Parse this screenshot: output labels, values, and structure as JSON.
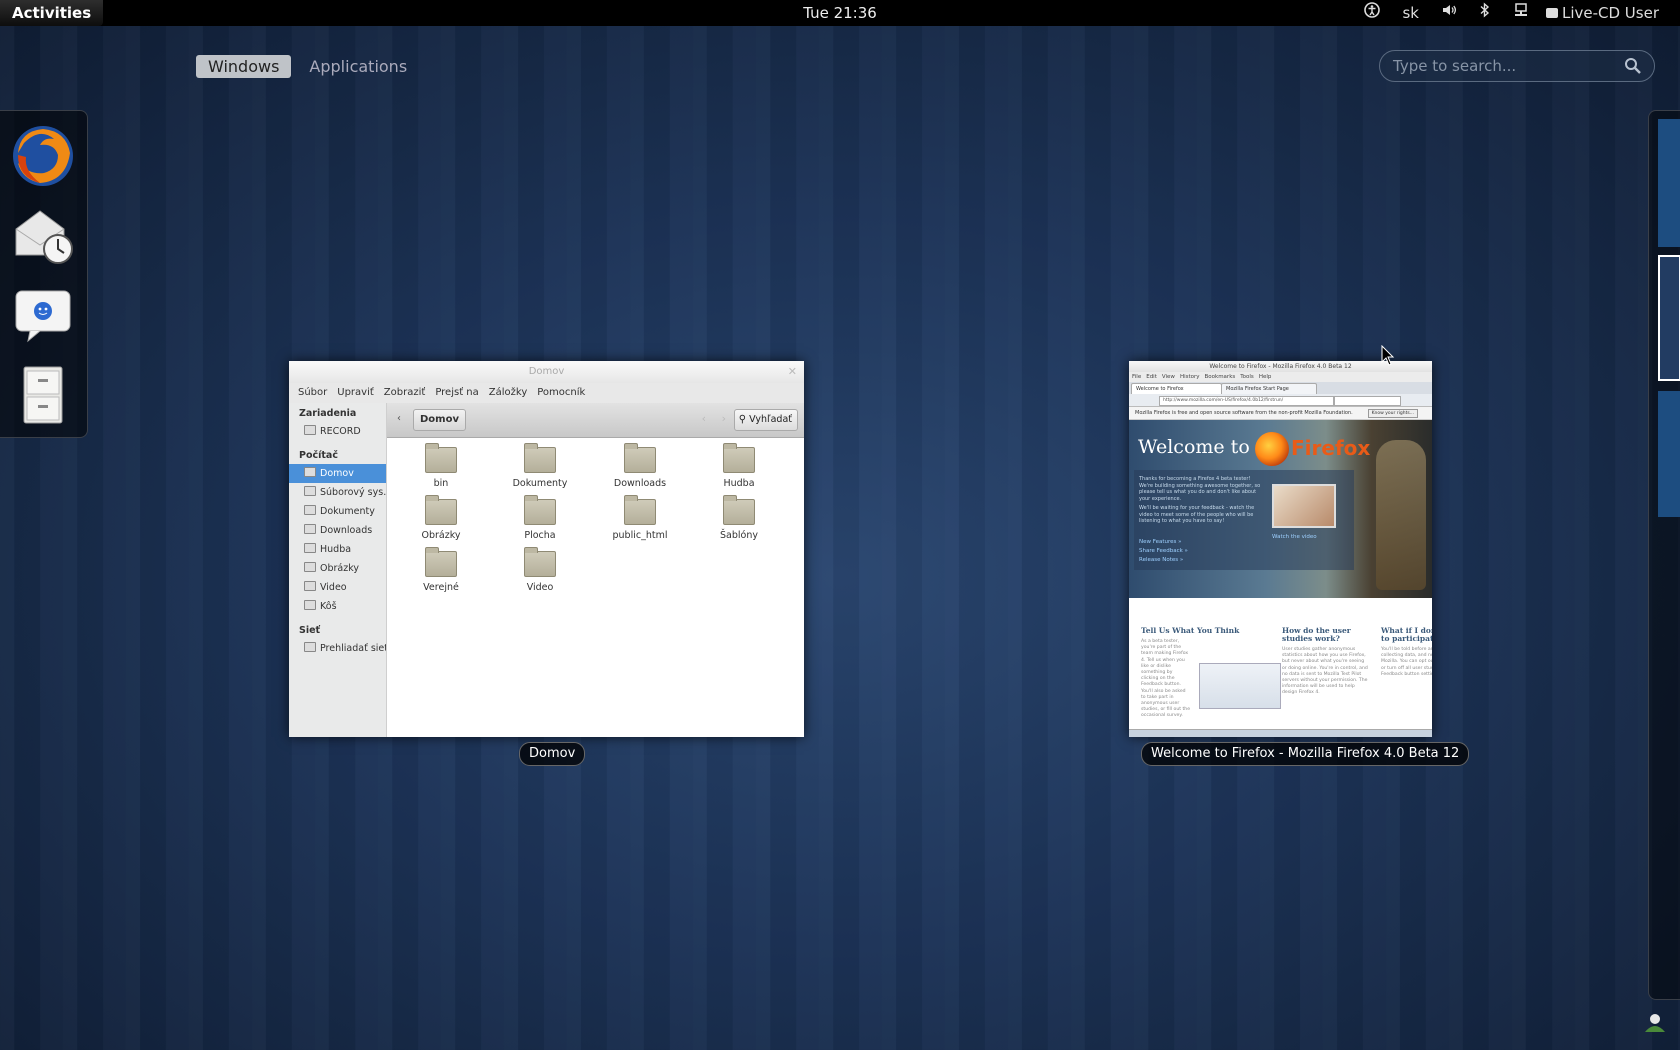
{
  "topbar": {
    "activities": "Activities",
    "clock": "Tue 21:36",
    "keyboard_layout": "sk",
    "user": "Live-CD User",
    "icons": [
      "accessibility-icon",
      "volume-icon",
      "bluetooth-icon",
      "network-icon",
      "chat-status-icon"
    ]
  },
  "overview": {
    "tabs": [
      "Windows",
      "Applications"
    ],
    "active_tab": "Windows",
    "search_placeholder": "Type to search..."
  },
  "dash": {
    "apps": [
      "firefox-icon",
      "evolution-mail-icon",
      "empathy-chat-icon",
      "file-cabinet-icon"
    ]
  },
  "nautilus": {
    "title": "Domov",
    "menu": [
      "Súbor",
      "Upraviť",
      "Zobraziť",
      "Prejsť na",
      "Záložky",
      "Pomocník"
    ],
    "sidebar": {
      "devices_header": "Zariadenia",
      "devices": [
        "RECORD"
      ],
      "computer_header": "Počítač",
      "computer": [
        "Domov",
        "Súborový sys...",
        "Dokumenty",
        "Downloads",
        "Hudba",
        "Obrázky",
        "Video",
        "Kôš"
      ],
      "selected": "Domov",
      "network_header": "Sieť",
      "network": [
        "Prehliadať sieť"
      ]
    },
    "path": "Domov",
    "search_button": "Vyhľadať",
    "files": [
      "bin",
      "Dokumenty",
      "Downloads",
      "Hudba",
      "Obrázky",
      "Plocha",
      "public_html",
      "Šablóny",
      "Verejné",
      "Video"
    ],
    "caption": "Domov"
  },
  "firefox": {
    "title": "Welcome to Firefox - Mozilla Firefox 4.0 Beta 12",
    "menu": [
      "File",
      "Edit",
      "View",
      "History",
      "Bookmarks",
      "Tools",
      "Help"
    ],
    "tabs": [
      "Welcome to Firefox",
      "Mozilla Firefox Start Page"
    ],
    "url": "http://www.mozilla.com/en-US/firefox/4.0b12/firstrun/",
    "notice": "Mozilla Firefox is free and open source software from the non-profit Mozilla Foundation.",
    "notice_button": "Know your rights...",
    "hero_title": "Welcome to",
    "hero_brand": "Firefox",
    "hero_text": "Thanks for becoming a Firefox 4 beta tester! We're building something awesome together, so please tell us what you do and don't like about your experience.",
    "hero_text2": "We'll be waiting for your feedback - watch the video to meet some of the people who will be listening to what you have to say!",
    "hero_links": [
      "New Features »",
      "Share Feedback »",
      "Release Notes »"
    ],
    "watch_video": "Watch the video",
    "col1_title": "Tell Us What You Think",
    "col1_text": "As a beta tester, you're part of the team making Firefox 4. Tell us when you like or dislike something by clicking on the Feedback button. You'll also be asked to take part in anonymous user studies, or fill out the occasional survey.",
    "col2_title": "How do the user studies work?",
    "col2_text": "User studies gather anonymous statistics about how you use Firefox, but never about what you're seeing or doing online. You're in control, and no data is sent to Mozilla Test Pilot servers without your permission. The information will be used to help design Firefox 4.",
    "col3_title": "What if I don't want to participate?",
    "col3_text": "You'll be told before any study begins collecting data, and no data is sent to Mozilla. You can opt out of any study, or turn off all user studies in the Feedback button settings.",
    "caption": "Welcome to Firefox - Mozilla Firefox 4.0 Beta 12"
  }
}
